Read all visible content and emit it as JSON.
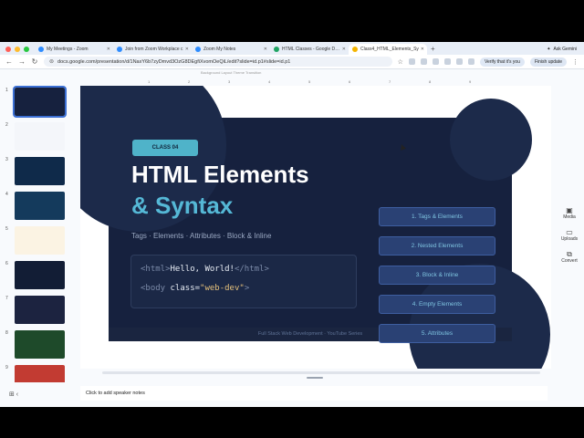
{
  "browser": {
    "tabs": [
      {
        "title": "My Meetings - Zoom",
        "color": "#2d8cff"
      },
      {
        "title": "Join from Zoom Workplace c",
        "color": "#2d8cff"
      },
      {
        "title": "Zoom My Notes",
        "color": "#2d8cff"
      },
      {
        "title": "HTML Classes - Google Drive",
        "color": "#1fa463"
      },
      {
        "title": "Class4_HTML_Elements_Sy",
        "color": "#f4b400"
      }
    ],
    "ask_gemini": "Ask Gemini",
    "url": "docs.google.com/presentation/d/1NaxY6b7zyDmvd3OzG8DEgfiXvomOeQiL/edit?slide=id.p1#slide=id.p1",
    "verify_label": "Verify that it's you",
    "finish_update": "Finish update"
  },
  "toolbar_text": "Background    Layout    Theme    Transition",
  "ruler": [
    "1",
    "2",
    "3",
    "4",
    "5",
    "6",
    "7",
    "8",
    "9"
  ],
  "filmstrip": [
    {
      "num": "1",
      "color": "#16213e"
    },
    {
      "num": "2",
      "color": "#f4f6fa"
    },
    {
      "num": "3",
      "color": "#0f2a4a"
    },
    {
      "num": "4",
      "color": "#143a5c"
    },
    {
      "num": "5",
      "color": "#fbf3e3"
    },
    {
      "num": "6",
      "color": "#121d35"
    },
    {
      "num": "7",
      "color": "#1c2340"
    },
    {
      "num": "8",
      "color": "#1e4a2a"
    },
    {
      "num": "9",
      "color": "#c23b32"
    }
  ],
  "slide": {
    "badge": "CLASS 04",
    "title_line1": "HTML Elements",
    "title_line2": "& Syntax",
    "subtitle": "Tags · Elements · Attributes · Block & Inline",
    "code": {
      "line1_open": "<html>",
      "line1_text": "Hello, World!",
      "line1_close": "</html>",
      "line2_open": "<body ",
      "line2_attr": "class=",
      "line2_val": "\"web-dev\"",
      "line2_end": ">"
    },
    "topics": [
      "1. Tags & Elements",
      "2. Nested Elements",
      "3. Block & Inline",
      "4. Empty Elements",
      "5. Attributes"
    ],
    "footer": "Full Stack Web Development · YouTube Series"
  },
  "notes_placeholder": "Click to add speaker notes",
  "sidebar": {
    "media": "Media",
    "uploads": "Uploads",
    "convert": "Convert"
  }
}
